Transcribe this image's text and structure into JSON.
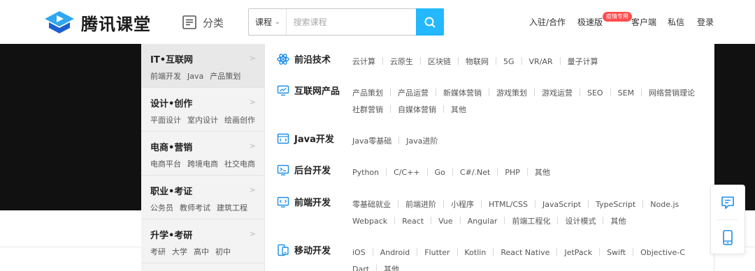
{
  "header": {
    "logo_text": "腾讯课堂",
    "category_label": "分类",
    "search": {
      "type_label": "课程",
      "placeholder": "搜索课程"
    },
    "nav": {
      "join": "入驻/合作",
      "speed": "极速版",
      "speed_badge": "疫情专用",
      "client": "客户端",
      "messages": "私信",
      "login": "登录"
    }
  },
  "left_categories": [
    {
      "title": "IT•互联网",
      "subs": [
        "前端开发",
        "Java",
        "产品策划"
      ]
    },
    {
      "title": "设计•创作",
      "subs": [
        "平面设计",
        "室内设计",
        "绘画创作"
      ]
    },
    {
      "title": "电商•营销",
      "subs": [
        "电商平台",
        "跨境电商",
        "社交电商"
      ]
    },
    {
      "title": "职业•考证",
      "subs": [
        "公务员",
        "教师考试",
        "建筑工程"
      ]
    },
    {
      "title": "升学•考研",
      "subs": [
        "考研",
        "大学",
        "高中",
        "初中"
      ]
    }
  ],
  "groups": [
    {
      "title": "前沿技术",
      "icon": "atom-icon",
      "lines": [
        [
          "云计算",
          "云原生",
          "区块链",
          "物联网",
          "5G",
          "VR/AR",
          "量子计算"
        ]
      ]
    },
    {
      "title": "互联网产品",
      "icon": "monitor-icon",
      "lines": [
        [
          "产品策划",
          "产品运营",
          "新媒体营销",
          "游戏策划",
          "游戏运营",
          "SEO",
          "SEM",
          "网络营销理论"
        ],
        [
          "社群营销",
          "自媒体营销",
          "其他"
        ]
      ]
    },
    {
      "title": "Java开发",
      "icon": "java-icon",
      "lines": [
        [
          "Java零基础",
          "Java进阶"
        ]
      ]
    },
    {
      "title": "后台开发",
      "icon": "server-icon",
      "lines": [
        [
          "Python",
          "C/C++",
          "Go",
          "C#/.Net",
          "PHP",
          "其他"
        ]
      ]
    },
    {
      "title": "前端开发",
      "icon": "frontend-icon",
      "lines": [
        [
          "零基础就业",
          "前端进阶",
          "小程序",
          "HTML/CSS",
          "JavaScript",
          "TypeScript",
          "Node.js"
        ],
        [
          "Webpack",
          "React",
          "Vue",
          "Angular",
          "前端工程化",
          "设计模式",
          "其他"
        ]
      ]
    },
    {
      "title": "移动开发",
      "icon": "mobile-dev-icon",
      "lines": [
        [
          "iOS",
          "Android",
          "Flutter",
          "Kotlin",
          "React Native",
          "JetPack",
          "Swift",
          "Objective-C"
        ],
        [
          "Dart",
          "其他"
        ]
      ]
    }
  ],
  "colors": {
    "accent": "#23b8ff",
    "icon_blue": "#1e8ee8",
    "banner": "#111111",
    "badge": "#ff4d4f"
  }
}
